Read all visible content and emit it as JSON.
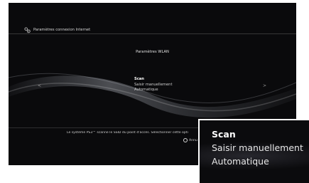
{
  "header": {
    "title": "Paramètres connexion Internet",
    "icon": "network-settings-icon"
  },
  "section": {
    "title": "Paramètres WLAN"
  },
  "menu": {
    "items": [
      {
        "label": "Scan",
        "selected": true
      },
      {
        "label": "Saisir manuellement",
        "selected": false
      },
      {
        "label": "Automatique",
        "selected": false
      }
    ],
    "left_arrow": "<",
    "right_arrow": ">"
  },
  "footer": {
    "info_text": "Le système PS3™ scanne le SSID du point d'accès. Sélectionner cette opti",
    "cancel_label": "Annu"
  },
  "zoom": {
    "items": [
      {
        "label": "Scan",
        "selected": true
      },
      {
        "label": "Saisir manuellement",
        "selected": false
      },
      {
        "label": "Automatique",
        "selected": false
      }
    ]
  }
}
